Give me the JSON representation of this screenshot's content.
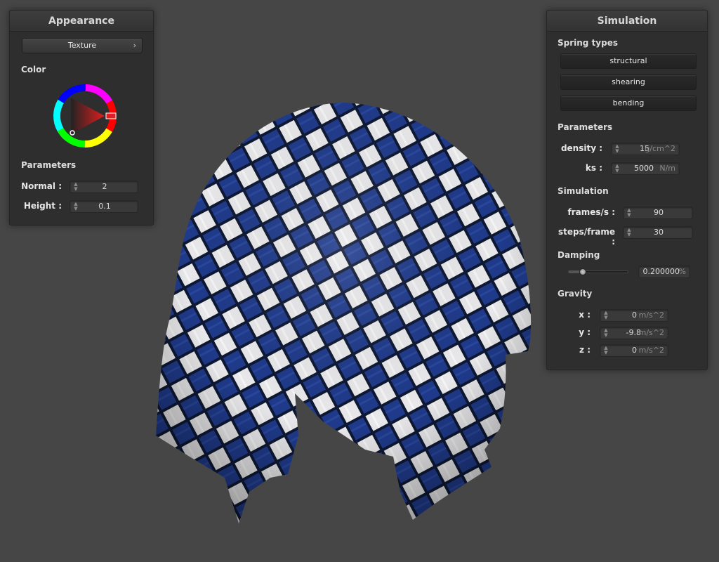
{
  "appearance": {
    "title": "Appearance",
    "texture_button": "Texture",
    "color_label": "Color",
    "parameters_label": "Parameters",
    "normal_label": "Normal :",
    "normal_value": "2",
    "height_label": "Height :",
    "height_value": "0.1",
    "selected_color": "#e02020"
  },
  "simulation": {
    "title": "Simulation",
    "spring_types_label": "Spring types",
    "springs": [
      "structural",
      "shearing",
      "bending"
    ],
    "parameters_label": "Parameters",
    "density_label": "density :",
    "density_value": "15",
    "density_unit": "g/cm^2",
    "ks_label": "ks :",
    "ks_value": "5000",
    "ks_unit": "N/m",
    "simulation_label": "Simulation",
    "fps_label": "frames/s :",
    "fps_value": "90",
    "steps_label": "steps/frame :",
    "steps_value": "30",
    "damping_label": "Damping",
    "damping_value": "0.200000",
    "damping_unit": "%",
    "damping_fraction": 0.2,
    "gravity_label": "Gravity",
    "gx_label": "x :",
    "gx_value": "0",
    "gy_label": "y :",
    "gy_value": "-9.8",
    "gz_label": "z :",
    "gz_value": "0",
    "gravity_unit": "m/s^2"
  },
  "scene": {
    "cloth_colors": {
      "blue": "#1f3a8a",
      "white": "#e8e8ea",
      "background": "#464646"
    }
  }
}
